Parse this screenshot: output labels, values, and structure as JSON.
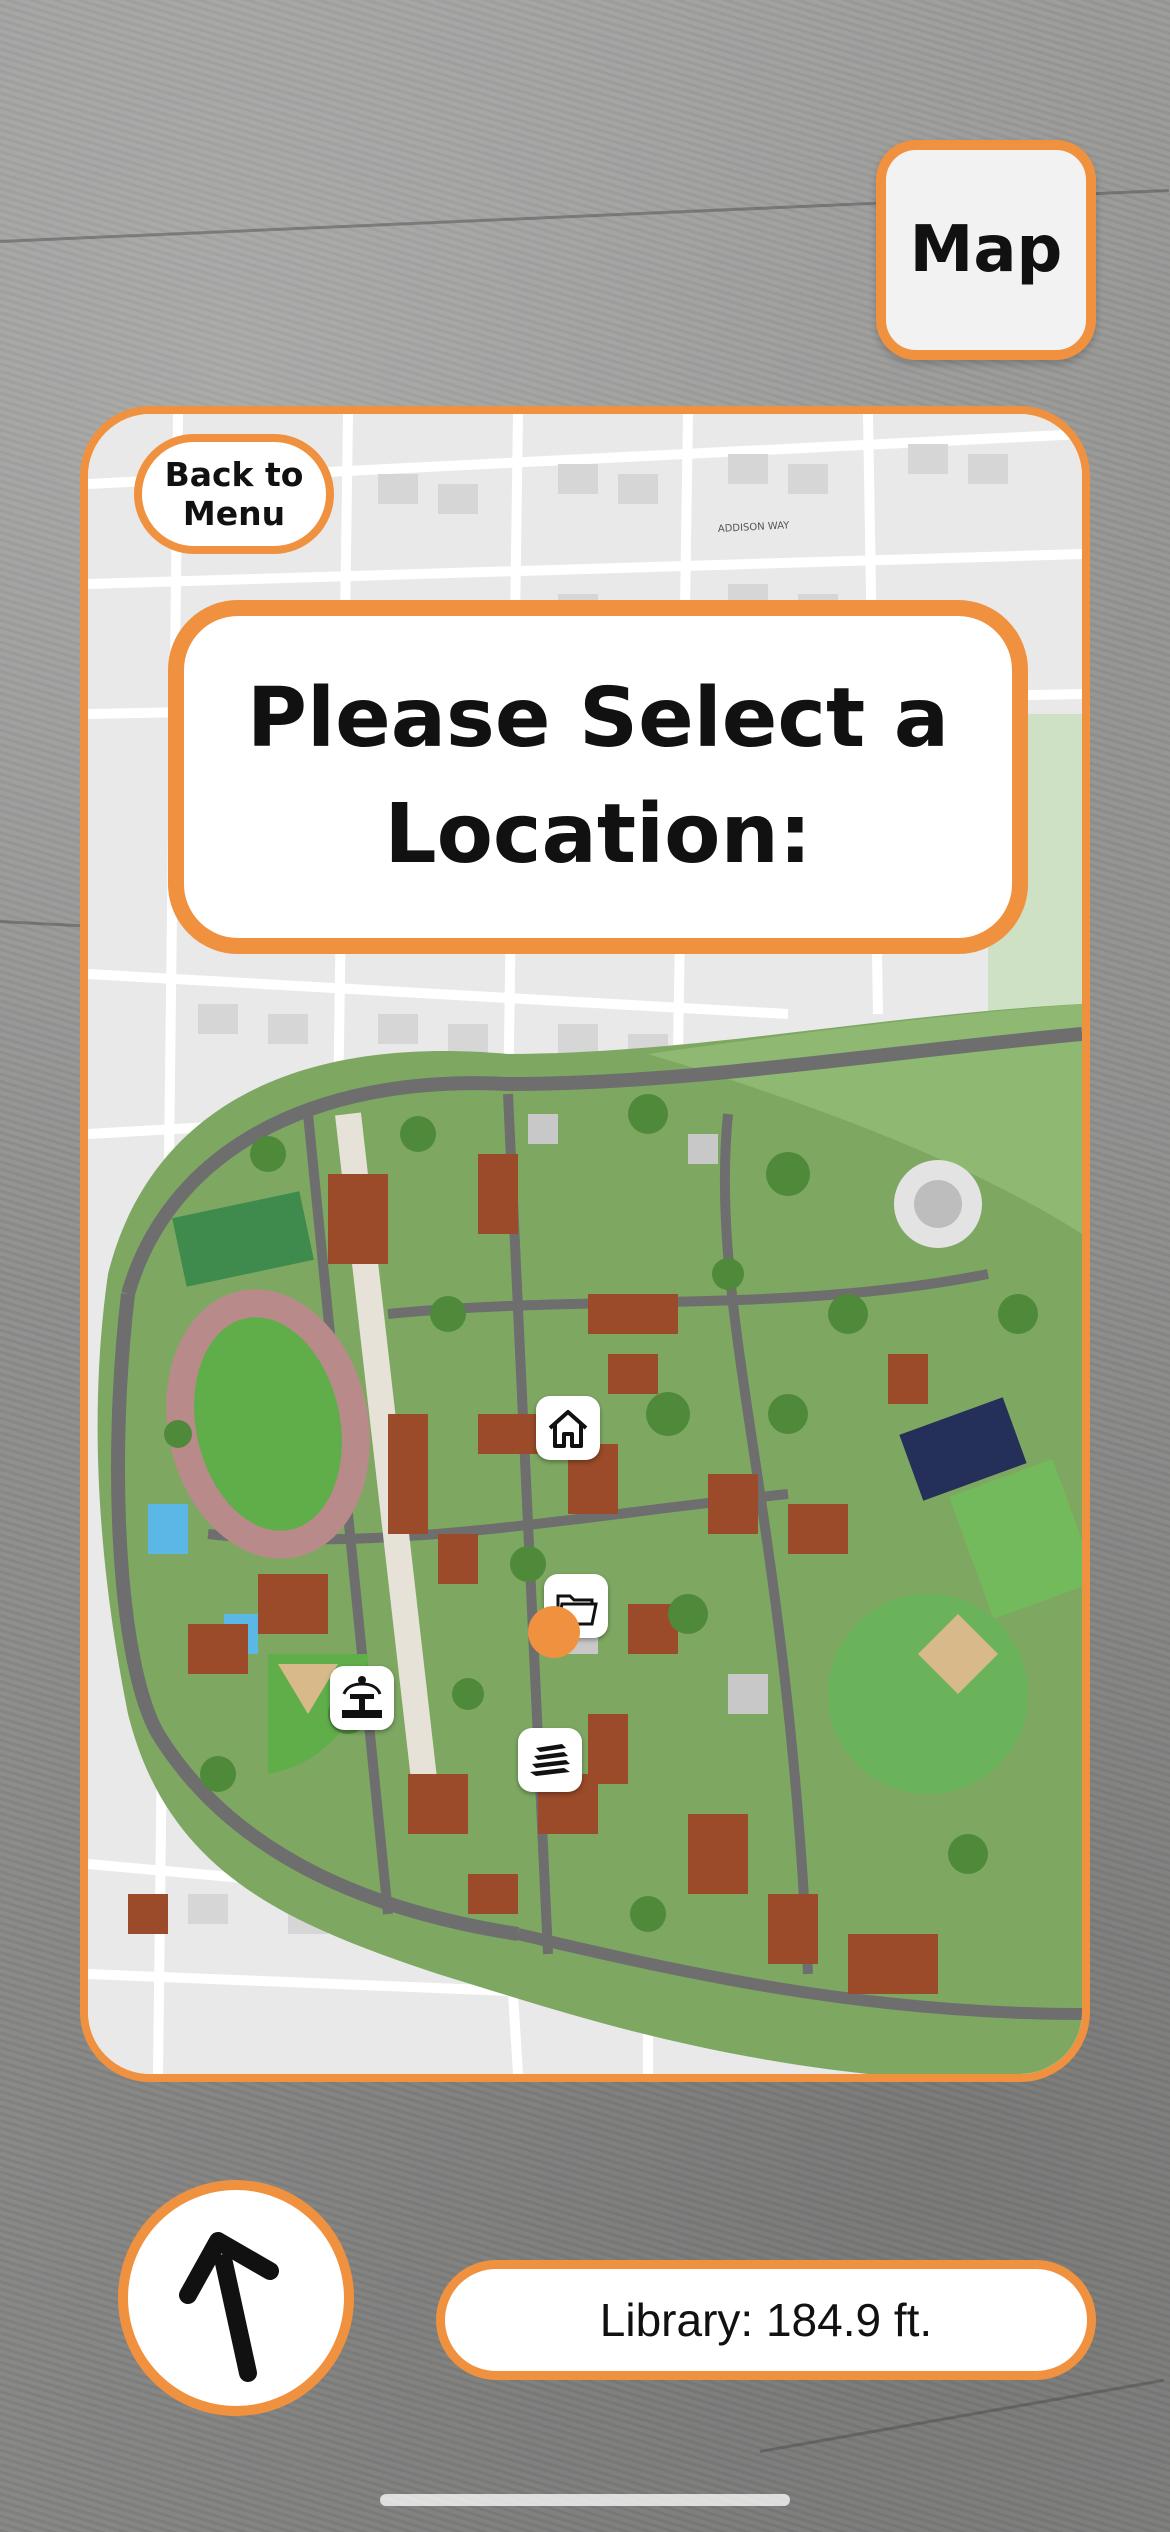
{
  "header": {
    "map_button_label": "Map"
  },
  "map_card": {
    "back_button_label": "Back to\nMenu",
    "prompt_text": "Please Select a Location:",
    "street_labels": {
      "addison_way": "ADDISON WAY"
    },
    "pins": [
      {
        "name": "home",
        "icon": "home-icon"
      },
      {
        "name": "folder",
        "icon": "folder-icon"
      },
      {
        "name": "fountain",
        "icon": "fountain-icon"
      },
      {
        "name": "books",
        "icon": "books-icon"
      }
    ]
  },
  "navigation": {
    "arrow_icon": "arrow-up-icon",
    "distance_text": "Library: 184.9 ft."
  },
  "colors": {
    "accent": "#f0913f",
    "campus_green": "#7ea862",
    "roof_brown": "#9b4a2a",
    "road_gray": "#6e6e6e"
  }
}
